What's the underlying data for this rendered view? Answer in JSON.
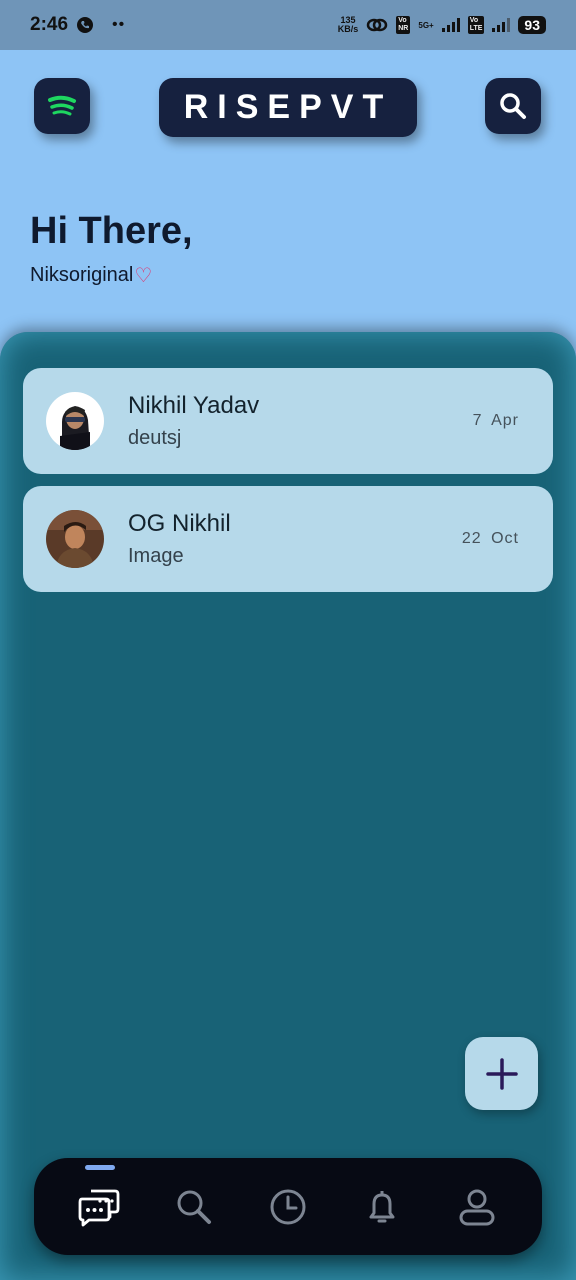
{
  "status_bar": {
    "time": "2:46",
    "net_speed_value": "135",
    "net_speed_unit": "KB/s",
    "network_label": "5G+",
    "battery": "93"
  },
  "header": {
    "app_title": "RISEPVT",
    "left_icon": "spotify-icon",
    "right_icon": "search-icon"
  },
  "greeting": {
    "title": "Hi There,",
    "username": "Niksoriginal",
    "heart": "♡"
  },
  "chats": [
    {
      "name": "Nikhil Yadav",
      "last_message": "deutsj",
      "date": "7  Apr"
    },
    {
      "name": "OG Nikhil",
      "last_message": "Image",
      "date": "22  Oct"
    }
  ],
  "fab": {
    "icon": "plus-icon"
  },
  "bottom_nav": {
    "items": [
      "chats-icon",
      "search-icon",
      "history-icon",
      "notifications-icon",
      "profile-icon"
    ],
    "active_index": 0
  },
  "colors": {
    "background": "#8ec4f5",
    "panel": "#186276",
    "card": "#b6d9ea",
    "dark": "#16213f",
    "accent": "#7fa9f0",
    "spotify": "#1ed760",
    "heart": "#e0336b"
  }
}
